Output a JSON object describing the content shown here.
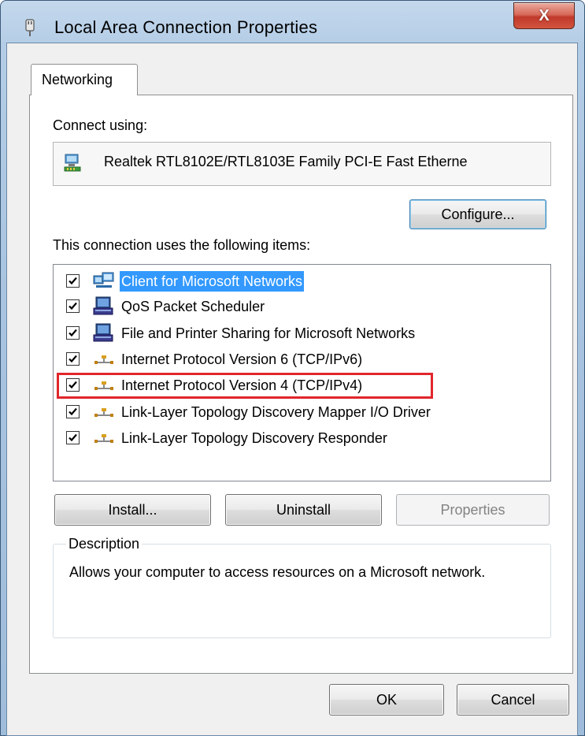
{
  "window": {
    "title": "Local Area Connection Properties",
    "close_label": "X",
    "accent_color": "#3399ff"
  },
  "tabs": [
    {
      "label": "Networking",
      "active": true
    }
  ],
  "connect_using": {
    "label": "Connect using:",
    "adapter_name": "Realtek RTL8102E/RTL8103E Family PCI-E Fast Etherne",
    "adapter_icon": "network-adapter-icon"
  },
  "buttons": {
    "configure": "Configure...",
    "install": "Install...",
    "uninstall": "Uninstall",
    "properties": "Properties",
    "ok": "OK",
    "cancel": "Cancel"
  },
  "items_section": {
    "label": "This connection uses the following items:",
    "items": [
      {
        "label": "Client for Microsoft Networks",
        "checked": true,
        "selected": true,
        "icon": "network-client-icon"
      },
      {
        "label": "QoS Packet Scheduler",
        "checked": true,
        "selected": false,
        "icon": "service-icon"
      },
      {
        "label": "File and Printer Sharing for Microsoft Networks",
        "checked": true,
        "selected": false,
        "icon": "service-icon"
      },
      {
        "label": "Internet Protocol Version 6 (TCP/IPv6)",
        "checked": true,
        "selected": false,
        "icon": "protocol-icon"
      },
      {
        "label": "Internet Protocol Version 4 (TCP/IPv4)",
        "checked": true,
        "selected": false,
        "icon": "protocol-icon",
        "highlighted": true
      },
      {
        "label": "Link-Layer Topology Discovery Mapper I/O Driver",
        "checked": true,
        "selected": false,
        "icon": "protocol-icon"
      },
      {
        "label": "Link-Layer Topology Discovery Responder",
        "checked": true,
        "selected": false,
        "icon": "protocol-icon"
      }
    ]
  },
  "description": {
    "legend": "Description",
    "text": "Allows your computer to access resources on a Microsoft network."
  }
}
